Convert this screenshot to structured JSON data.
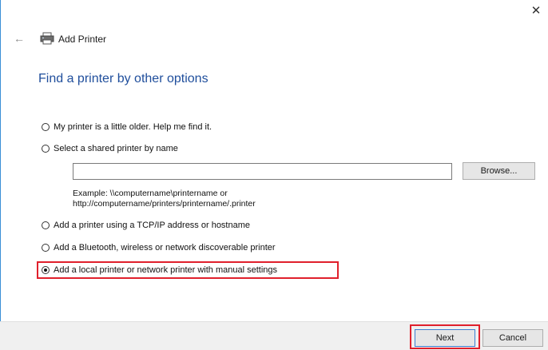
{
  "window": {
    "title": "Add Printer",
    "close_label": "✕"
  },
  "header": {
    "back_label": "←",
    "heading": "Find a printer by other options"
  },
  "options": [
    {
      "label": "My printer is a little older. Help me find it.",
      "checked": false
    },
    {
      "label": "Select a shared printer by name",
      "checked": false
    },
    {
      "label": "Add a printer using a TCP/IP address or hostname",
      "checked": false
    },
    {
      "label": "Add a Bluetooth, wireless or network discoverable printer",
      "checked": false
    },
    {
      "label": "Add a local printer or network printer with manual settings",
      "checked": true
    }
  ],
  "shared_printer": {
    "value": "",
    "browse_label": "Browse...",
    "example_line1": "Example: \\\\computername\\printername or",
    "example_line2": "http://computername/printers/printername/.printer"
  },
  "footer": {
    "next_label": "Next",
    "cancel_label": "Cancel"
  },
  "colors": {
    "heading": "#1f4e9c",
    "highlight": "#e0202c",
    "accent_border": "#3b8fd6"
  }
}
